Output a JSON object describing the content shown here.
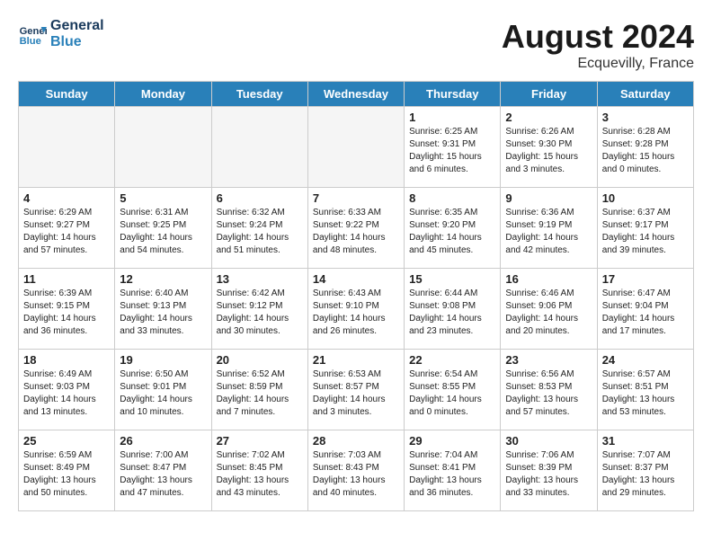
{
  "header": {
    "logo_line1": "General",
    "logo_line2": "Blue",
    "month_year": "August 2024",
    "location": "Ecquevilly, France"
  },
  "weekdays": [
    "Sunday",
    "Monday",
    "Tuesday",
    "Wednesday",
    "Thursday",
    "Friday",
    "Saturday"
  ],
  "weeks": [
    [
      {
        "day": "",
        "info": ""
      },
      {
        "day": "",
        "info": ""
      },
      {
        "day": "",
        "info": ""
      },
      {
        "day": "",
        "info": ""
      },
      {
        "day": "1",
        "info": "Sunrise: 6:25 AM\nSunset: 9:31 PM\nDaylight: 15 hours\nand 6 minutes."
      },
      {
        "day": "2",
        "info": "Sunrise: 6:26 AM\nSunset: 9:30 PM\nDaylight: 15 hours\nand 3 minutes."
      },
      {
        "day": "3",
        "info": "Sunrise: 6:28 AM\nSunset: 9:28 PM\nDaylight: 15 hours\nand 0 minutes."
      }
    ],
    [
      {
        "day": "4",
        "info": "Sunrise: 6:29 AM\nSunset: 9:27 PM\nDaylight: 14 hours\nand 57 minutes."
      },
      {
        "day": "5",
        "info": "Sunrise: 6:31 AM\nSunset: 9:25 PM\nDaylight: 14 hours\nand 54 minutes."
      },
      {
        "day": "6",
        "info": "Sunrise: 6:32 AM\nSunset: 9:24 PM\nDaylight: 14 hours\nand 51 minutes."
      },
      {
        "day": "7",
        "info": "Sunrise: 6:33 AM\nSunset: 9:22 PM\nDaylight: 14 hours\nand 48 minutes."
      },
      {
        "day": "8",
        "info": "Sunrise: 6:35 AM\nSunset: 9:20 PM\nDaylight: 14 hours\nand 45 minutes."
      },
      {
        "day": "9",
        "info": "Sunrise: 6:36 AM\nSunset: 9:19 PM\nDaylight: 14 hours\nand 42 minutes."
      },
      {
        "day": "10",
        "info": "Sunrise: 6:37 AM\nSunset: 9:17 PM\nDaylight: 14 hours\nand 39 minutes."
      }
    ],
    [
      {
        "day": "11",
        "info": "Sunrise: 6:39 AM\nSunset: 9:15 PM\nDaylight: 14 hours\nand 36 minutes."
      },
      {
        "day": "12",
        "info": "Sunrise: 6:40 AM\nSunset: 9:13 PM\nDaylight: 14 hours\nand 33 minutes."
      },
      {
        "day": "13",
        "info": "Sunrise: 6:42 AM\nSunset: 9:12 PM\nDaylight: 14 hours\nand 30 minutes."
      },
      {
        "day": "14",
        "info": "Sunrise: 6:43 AM\nSunset: 9:10 PM\nDaylight: 14 hours\nand 26 minutes."
      },
      {
        "day": "15",
        "info": "Sunrise: 6:44 AM\nSunset: 9:08 PM\nDaylight: 14 hours\nand 23 minutes."
      },
      {
        "day": "16",
        "info": "Sunrise: 6:46 AM\nSunset: 9:06 PM\nDaylight: 14 hours\nand 20 minutes."
      },
      {
        "day": "17",
        "info": "Sunrise: 6:47 AM\nSunset: 9:04 PM\nDaylight: 14 hours\nand 17 minutes."
      }
    ],
    [
      {
        "day": "18",
        "info": "Sunrise: 6:49 AM\nSunset: 9:03 PM\nDaylight: 14 hours\nand 13 minutes."
      },
      {
        "day": "19",
        "info": "Sunrise: 6:50 AM\nSunset: 9:01 PM\nDaylight: 14 hours\nand 10 minutes."
      },
      {
        "day": "20",
        "info": "Sunrise: 6:52 AM\nSunset: 8:59 PM\nDaylight: 14 hours\nand 7 minutes."
      },
      {
        "day": "21",
        "info": "Sunrise: 6:53 AM\nSunset: 8:57 PM\nDaylight: 14 hours\nand 3 minutes."
      },
      {
        "day": "22",
        "info": "Sunrise: 6:54 AM\nSunset: 8:55 PM\nDaylight: 14 hours\nand 0 minutes."
      },
      {
        "day": "23",
        "info": "Sunrise: 6:56 AM\nSunset: 8:53 PM\nDaylight: 13 hours\nand 57 minutes."
      },
      {
        "day": "24",
        "info": "Sunrise: 6:57 AM\nSunset: 8:51 PM\nDaylight: 13 hours\nand 53 minutes."
      }
    ],
    [
      {
        "day": "25",
        "info": "Sunrise: 6:59 AM\nSunset: 8:49 PM\nDaylight: 13 hours\nand 50 minutes."
      },
      {
        "day": "26",
        "info": "Sunrise: 7:00 AM\nSunset: 8:47 PM\nDaylight: 13 hours\nand 47 minutes."
      },
      {
        "day": "27",
        "info": "Sunrise: 7:02 AM\nSunset: 8:45 PM\nDaylight: 13 hours\nand 43 minutes."
      },
      {
        "day": "28",
        "info": "Sunrise: 7:03 AM\nSunset: 8:43 PM\nDaylight: 13 hours\nand 40 minutes."
      },
      {
        "day": "29",
        "info": "Sunrise: 7:04 AM\nSunset: 8:41 PM\nDaylight: 13 hours\nand 36 minutes."
      },
      {
        "day": "30",
        "info": "Sunrise: 7:06 AM\nSunset: 8:39 PM\nDaylight: 13 hours\nand 33 minutes."
      },
      {
        "day": "31",
        "info": "Sunrise: 7:07 AM\nSunset: 8:37 PM\nDaylight: 13 hours\nand 29 minutes."
      }
    ]
  ]
}
